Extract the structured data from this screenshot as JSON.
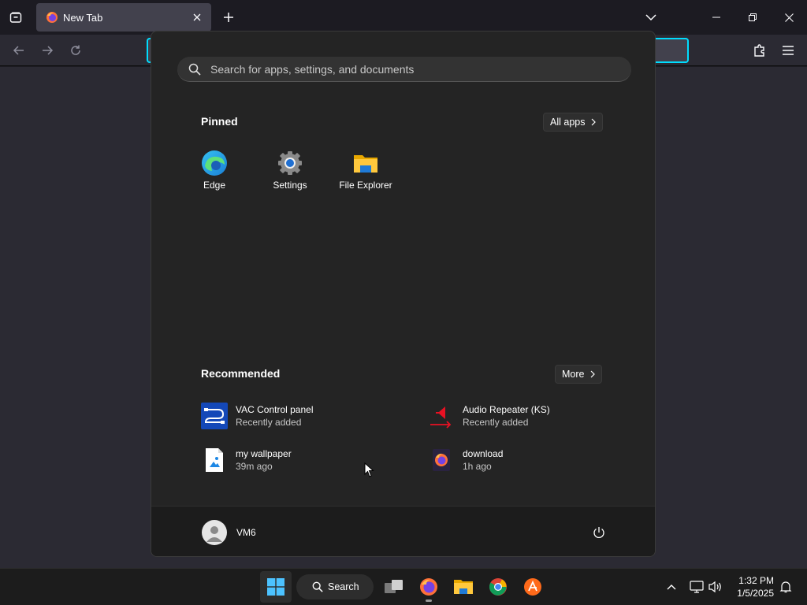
{
  "browser": {
    "tab": {
      "title": "New Tab"
    }
  },
  "start_menu": {
    "search": {
      "placeholder": "Search for apps, settings, and documents"
    },
    "pinned": {
      "title": "Pinned",
      "all_apps_label": "All apps",
      "apps": [
        {
          "label": "Edge",
          "icon": "edge-icon"
        },
        {
          "label": "Settings",
          "icon": "settings-gear-icon"
        },
        {
          "label": "File Explorer",
          "icon": "folder-icon"
        }
      ]
    },
    "recommended": {
      "title": "Recommended",
      "more_label": "More",
      "items": [
        {
          "name": "VAC Control panel",
          "detail": "Recently added",
          "icon": "vac-cable-icon"
        },
        {
          "name": "Audio Repeater (KS)",
          "detail": "Recently added",
          "icon": "speaker-arrow-icon"
        },
        {
          "name": "my wallpaper",
          "detail": "39m ago",
          "icon": "image-file-icon"
        },
        {
          "name": "download",
          "detail": "1h ago",
          "icon": "firefox-file-icon"
        }
      ]
    },
    "user": {
      "name": "VM6"
    }
  },
  "taskbar": {
    "search_label": "Search",
    "time": "1:32 PM",
    "date": "1/5/2025"
  },
  "colors": {
    "accent": "#00ddff",
    "start_bg": "#242424",
    "taskbar_bg": "#1c1c1c"
  }
}
